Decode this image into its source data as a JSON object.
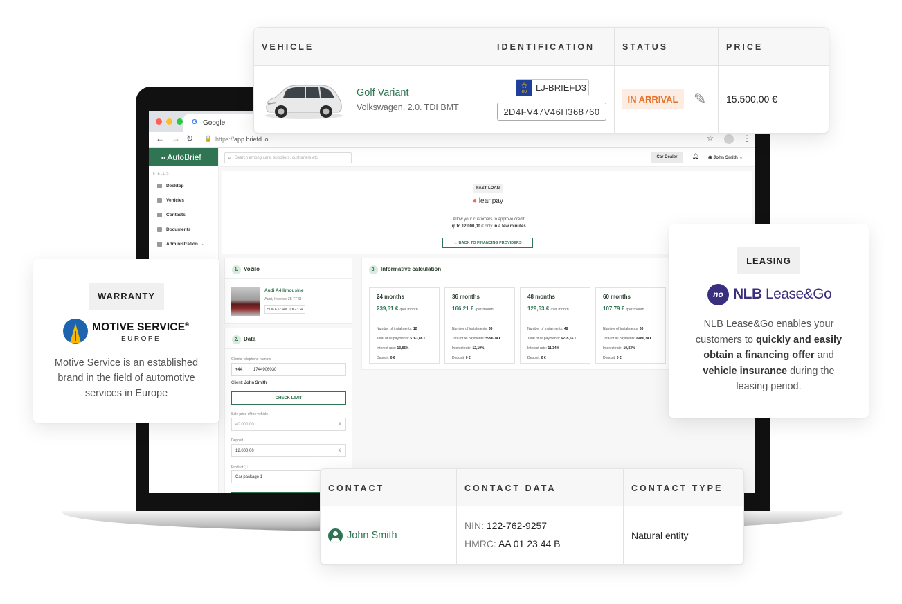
{
  "browser": {
    "tab_title": "Google",
    "url_prefix": "https://",
    "url_host": "app.briefd.io"
  },
  "app": {
    "logo": "AutoBrief",
    "search_placeholder": "Search among cars, suppliers, customers etc",
    "dealer_button": "Car Dealer",
    "user_name": "John Smith",
    "sidebar": {
      "section_label": "FIELDS",
      "items": [
        {
          "label": "Desktop",
          "icon": "desktop-icon"
        },
        {
          "label": "Vehicles",
          "icon": "car-icon"
        },
        {
          "label": "Contacts",
          "icon": "contacts-icon"
        },
        {
          "label": "Documents",
          "icon": "document-icon"
        },
        {
          "label": "Administration",
          "icon": "admin-icon"
        }
      ]
    },
    "loan": {
      "badge": "FAST LOAN",
      "provider": "leanpay",
      "desc_line1": "Allow your customers to approve credit",
      "desc_amount": "up to 12.000,00 €",
      "desc_mid": " only ",
      "desc_speed": "in a few minutes.",
      "back_button": "BACK TO FINANCING PROVIDERS"
    },
    "vozilo": {
      "step": "1.",
      "title": "Vozilo",
      "car_name": "Audi A4 limousine",
      "car_sub": "Audi, Intense 35 TFSI",
      "car_vin": "5DKFJ234KJLK23J4"
    },
    "data_panel": {
      "step": "2.",
      "title": "Data",
      "phone_label": "Clients' telephone number",
      "phone_prefix": "+44",
      "phone_value": "1744906030",
      "client_prefix": "Client: ",
      "client_name": "John Smith",
      "check_button": "CHECK LIMIT",
      "price_label": "Sale price of the vehicle",
      "price_value": "40.000,00",
      "deposit_label": "Deposit",
      "deposit_value": "12.000,00",
      "currency": "€",
      "product_label": "Product",
      "product_value": "Car package 1"
    },
    "calc": {
      "step": "3.",
      "title": "Informative calculation",
      "row_labels": {
        "instalments": "Number of instalments:",
        "total": "Total of all payments:",
        "interest": "Interest rate:",
        "deposit": "Deposit:"
      },
      "per_month": "/per month",
      "plans": [
        {
          "title": "24 months",
          "amount": "239,61 €",
          "instalments": "12",
          "total": "5763,88 €",
          "interest": "13,85%",
          "deposit": "0 €"
        },
        {
          "title": "36 months",
          "amount": "166,21 €",
          "instalments": "36",
          "total": "5996,74 €",
          "interest": "12,19%",
          "deposit": "0 €"
        },
        {
          "title": "48 months",
          "amount": "129,63 €",
          "instalments": "48",
          "total": "6235,65 €",
          "interest": "11,34%",
          "deposit": "0 €"
        },
        {
          "title": "60 months",
          "amount": "107,79 €",
          "instalments": "60",
          "total": "6480,34 €",
          "interest": "10,83%",
          "deposit": "0 €"
        }
      ]
    }
  },
  "vehicle_table": {
    "headers": [
      "VEHICLE",
      "IDENTIFICATION",
      "STATUS",
      "PRICE"
    ],
    "name": "Golf Variant",
    "sub": "Volkswagen, 2.0. TDI BMT",
    "plate_country": "EU",
    "plate": "LJ-BRIEFD3",
    "vin": "2D4FV47V46H368760",
    "status": "IN ARRIVAL",
    "price": "15.500,00 €"
  },
  "warranty": {
    "tag": "WARRANTY",
    "logo_title": "MOTIVE SERVICE",
    "logo_reg": "®",
    "logo_sub": "EUROPE",
    "desc": "Motive Service is an established brand in the field of automotive services in Europe"
  },
  "leasing": {
    "tag": "LEASING",
    "logo_mark": "no",
    "logo_bold": "NLB",
    "logo_rest": " Lease&Go",
    "desc_1": "NLB Lease&Go enables your customers to ",
    "desc_bold_1": "quickly and easily obtain a financing offer",
    "desc_2": " and ",
    "desc_bold_2": "vehicle insurance",
    "desc_3": " during the leasing period."
  },
  "contact_table": {
    "headers": [
      "CONTACT",
      "CONTACT DATA",
      "CONTACT TYPE"
    ],
    "name": "John Smith",
    "nin_label": "NIN: ",
    "nin_value": "122-762-9257",
    "hmrc_label": "HMRC: ",
    "hmrc_value": "AA 01 23 44 B",
    "type": "Natural entity"
  },
  "colors": {
    "brand_green": "#2f7453",
    "status_orange": "#e5722c",
    "status_bg": "#fdece1",
    "nlb_purple": "#3a2f7f",
    "motive_blue": "#1e63ad",
    "motive_yellow": "#f5b800"
  }
}
